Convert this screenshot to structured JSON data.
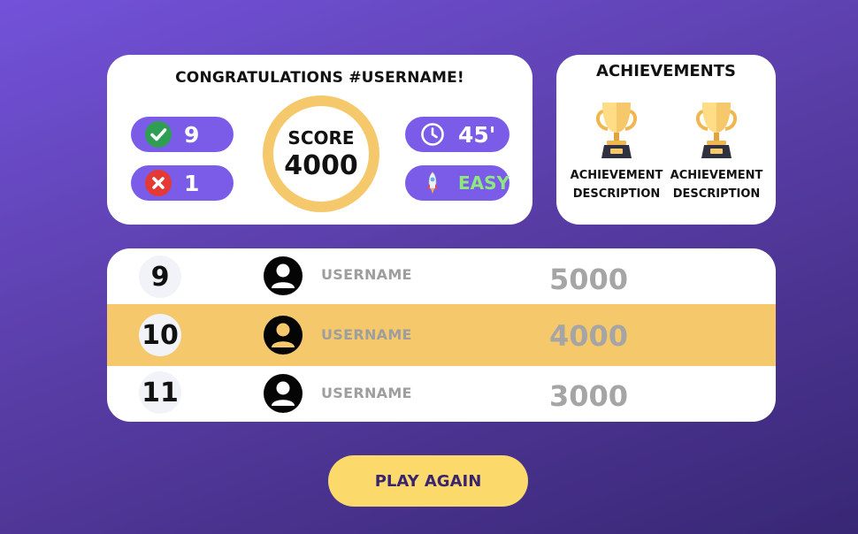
{
  "results": {
    "title": "CONGRATULATIONS #USERNAME!",
    "correct": "9",
    "wrong": "1",
    "score_label": "SCORE",
    "score_value": "4000",
    "time": "45'",
    "difficulty": "EASY",
    "icons": {
      "correct": "check-circle-icon",
      "wrong": "x-circle-icon",
      "time": "clock-icon",
      "difficulty": "rocket-icon"
    }
  },
  "achievements": {
    "title": "ACHIEVEMENTS",
    "items": [
      {
        "icon": "trophy-icon",
        "description": "ACHIEVEMENT DESCRIPTION"
      },
      {
        "icon": "trophy-icon",
        "description": "ACHIEVEMENT DESCRIPTION"
      }
    ]
  },
  "leaderboard": {
    "rows": [
      {
        "rank": "9",
        "username": "USERNAME",
        "score": "5000",
        "highlight": false
      },
      {
        "rank": "10",
        "username": "USERNAME",
        "score": "4000",
        "highlight": true
      },
      {
        "rank": "11",
        "username": "USERNAME",
        "score": "3000",
        "highlight": false
      }
    ]
  },
  "play_again": {
    "label": "PLAY AGAIN"
  },
  "colors": {
    "background_start": "#7352d9",
    "background_end": "#382774",
    "pill": "#7a5ce8",
    "accent_gold": "#f5c96b",
    "button": "#fbd96a",
    "easy_text": "#8ee87d",
    "correct": "#2e9e52",
    "wrong": "#e53935"
  }
}
